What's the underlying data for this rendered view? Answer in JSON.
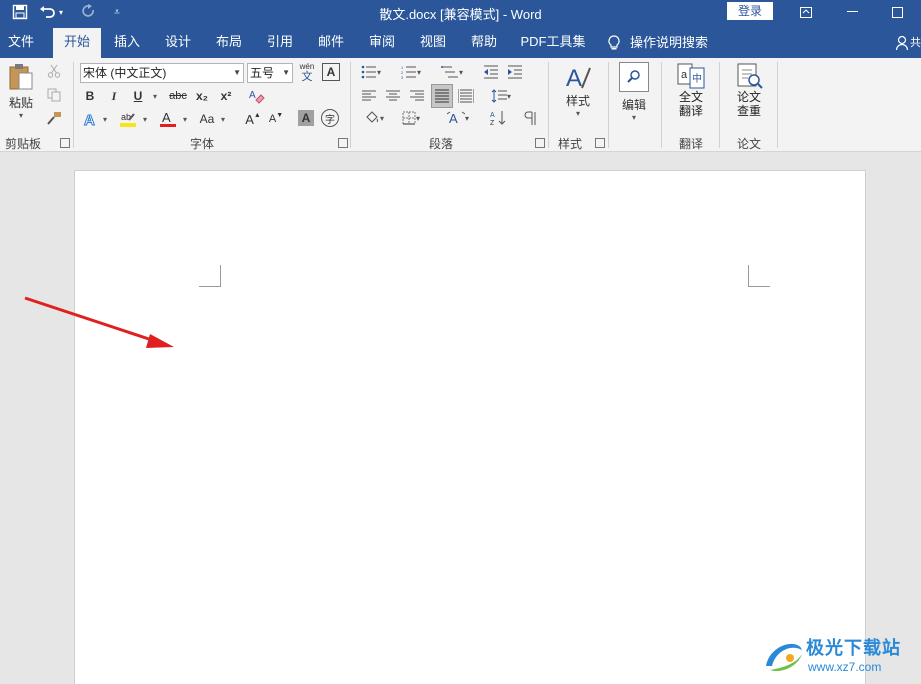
{
  "titlebar": {
    "title": "散文.docx [兼容模式]  -  Word",
    "login": "登录",
    "save_icon": "save-icon",
    "undo_icon": "undo-icon",
    "redo_icon": "redo-icon",
    "customize_icon": "customize-qat-icon"
  },
  "tabs": [
    "文件",
    "开始",
    "插入",
    "设计",
    "布局",
    "引用",
    "邮件",
    "审阅",
    "视图",
    "帮助",
    "PDF工具集"
  ],
  "tell_me": "操作说明搜索",
  "share_label": "共",
  "clipboard": {
    "paste": "粘贴",
    "group": "剪贴板"
  },
  "font": {
    "name": "宋体 (中文正文)",
    "size": "五号",
    "wen": "wén",
    "wen_char": "文",
    "bold": "B",
    "italic": "I",
    "underline": "U",
    "strike": "abc",
    "sub": "x₂",
    "sup": "x²",
    "case": "Aa",
    "grow": "A",
    "shrink": "A",
    "char_shade": "A",
    "enclose": "字",
    "group": "字体"
  },
  "paragraph": {
    "group": "段落"
  },
  "styles": {
    "label": "样式",
    "group": "样式"
  },
  "editing": {
    "label": "编辑"
  },
  "translate": {
    "label1": "全文",
    "label2": "翻译",
    "group": "翻译"
  },
  "paper": {
    "label1": "论文",
    "label2": "查重",
    "group": "论文"
  },
  "watermark": {
    "name": "极光下载站",
    "url": "www.xz7.com"
  },
  "colors": {
    "accent": "#2b579a",
    "arrow": "#e02020",
    "highlight": "#f7e51b",
    "font_color": "#e02020"
  }
}
